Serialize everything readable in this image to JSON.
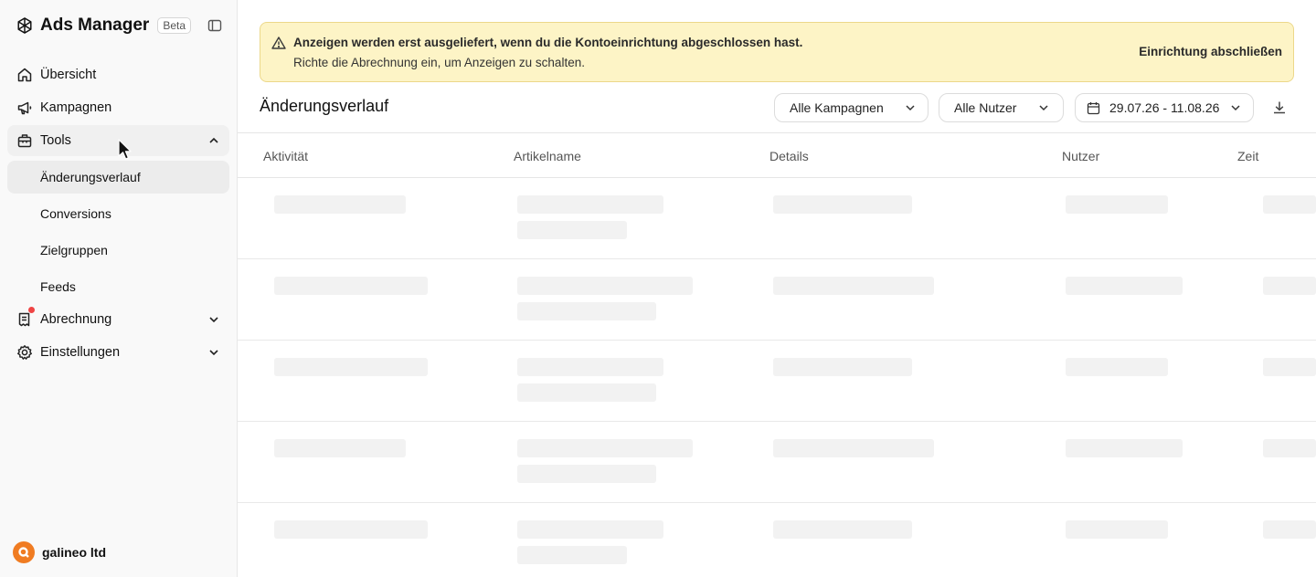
{
  "app": {
    "title": "Ads Manager",
    "badge": "Beta"
  },
  "sidebar": {
    "items": [
      {
        "label": "Übersicht",
        "icon": "home-icon"
      },
      {
        "label": "Kampagnen",
        "icon": "megaphone-icon"
      },
      {
        "label": "Tools",
        "icon": "toolbox-icon",
        "expanded": true
      },
      {
        "label": "Abrechnung",
        "icon": "receipt-icon",
        "notification": true
      },
      {
        "label": "Einstellungen",
        "icon": "gear-icon"
      }
    ],
    "tools_sub": [
      {
        "label": "Änderungsverlauf",
        "active": true
      },
      {
        "label": "Conversions"
      },
      {
        "label": "Zielgruppen"
      },
      {
        "label": "Feeds"
      }
    ],
    "account": {
      "name": "galineo ltd"
    }
  },
  "banner": {
    "title": "Anzeigen werden erst ausgeliefert, wenn du die Kontoeinrichtung abgeschlossen hast.",
    "subtitle": "Richte die Abrechnung ein, um Anzeigen zu schalten.",
    "action": "Einrichtung abschließen"
  },
  "main": {
    "title": "Änderungsverlauf",
    "filters": {
      "campaigns": "Alle Kampagnen",
      "users": "Alle Nutzer",
      "date_range": "29.07.26 - 11.08.26"
    },
    "columns": [
      "Aktivität",
      "Artikelname",
      "Details",
      "Nutzer",
      "Zeit"
    ]
  },
  "colors": {
    "banner_bg": "#fdf4c6",
    "accent_orange": "#f07c22",
    "notification": "#ef4444"
  }
}
